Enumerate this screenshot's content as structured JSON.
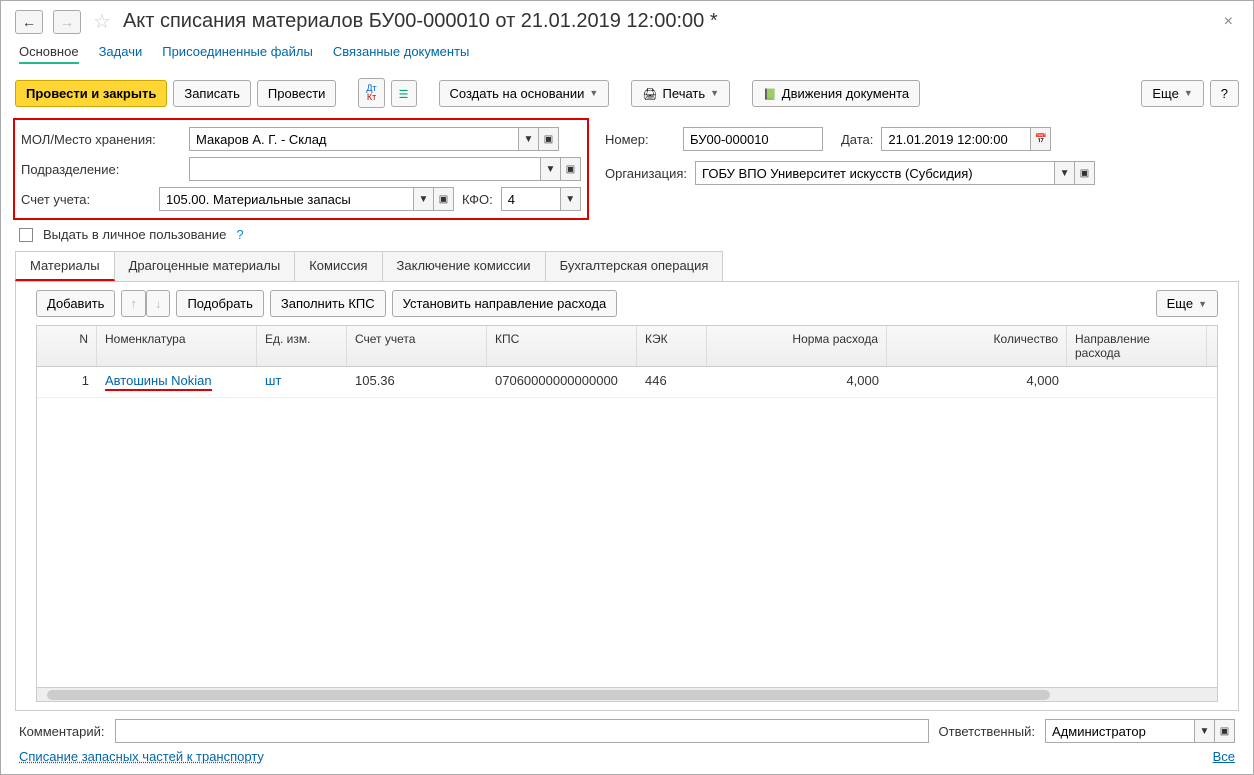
{
  "title": "Акт списания материалов БУ00-000010 от 21.01.2019 12:00:00 *",
  "topnav": {
    "main": "Основное",
    "tasks": "Задачи",
    "files": "Присоединенные файлы",
    "related": "Связанные документы"
  },
  "toolbar": {
    "post_close": "Провести и закрыть",
    "save": "Записать",
    "post": "Провести",
    "create_based": "Создать на основании",
    "print": "Печать",
    "movements": "Движения документа",
    "more": "Еще",
    "help": "?"
  },
  "fields": {
    "mol_label": "МОЛ/Место хранения:",
    "mol_value": "Макаров А. Г. - Склад",
    "dept_label": "Подразделение:",
    "dept_value": "",
    "account_label": "Счет учета:",
    "account_value": "105.00. Материальные запасы",
    "kfo_label": "КФО:",
    "kfo_value": "4",
    "number_label": "Номер:",
    "number_value": "БУ00-000010",
    "date_label": "Дата:",
    "date_value": "21.01.2019 12:00:00",
    "org_label": "Организация:",
    "org_value": "ГОБУ ВПО Университет искусств (Субсидия)",
    "personal_use": "Выдать в личное пользование"
  },
  "tabs": {
    "materials": "Материалы",
    "precious": "Драгоценные материалы",
    "commission": "Комиссия",
    "conclusion": "Заключение комиссии",
    "accounting": "Бухгалтерская операция"
  },
  "grid_toolbar": {
    "add": "Добавить",
    "pick": "Подобрать",
    "fill_kps": "Заполнить КПС",
    "set_direction": "Установить направление расхода",
    "more": "Еще"
  },
  "columns": {
    "n": "N",
    "nom": "Номенклатура",
    "ed": "Ед. изм.",
    "schet": "Счет учета",
    "kps": "КПС",
    "kek": "КЭК",
    "norma": "Норма расхода",
    "kol": "Количество",
    "napr": "Направление расхода"
  },
  "rows": [
    {
      "n": "1",
      "nom": "Автошины Nokian",
      "ed": "шт",
      "schet": "105.36",
      "kps": "07060000000000000",
      "kek": "446",
      "norma": "4,000",
      "kol": "4,000",
      "napr": ""
    }
  ],
  "bottom": {
    "comment_label": "Комментарий:",
    "comment_value": "",
    "resp_label": "Ответственный:",
    "resp_value": "Администратор"
  },
  "footer": {
    "link": "Списание запасных частей к транспорту",
    "all": "Все"
  }
}
